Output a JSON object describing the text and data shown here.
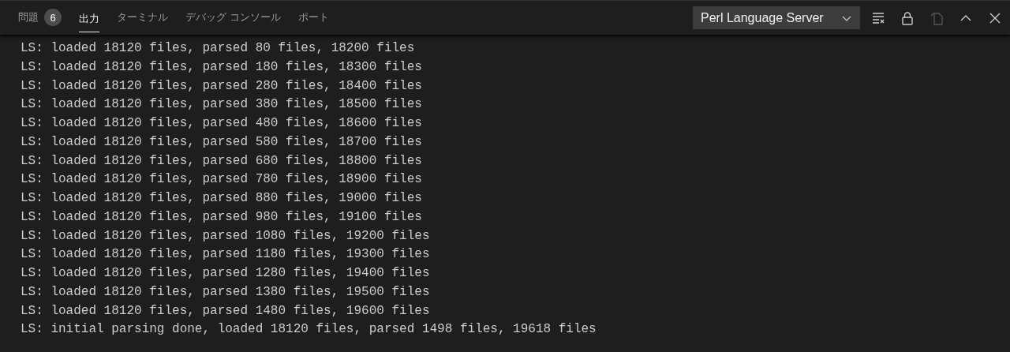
{
  "tabs": [
    {
      "label": "問題",
      "badge": "6",
      "selected": false
    },
    {
      "label": "出力",
      "selected": true
    },
    {
      "label": "ターミナル",
      "selected": false
    },
    {
      "label": "デバッグ コンソール",
      "selected": false
    },
    {
      "label": "ポート",
      "selected": false
    }
  ],
  "channel_dropdown": {
    "value": "Perl Language Server"
  },
  "toolbar": [
    {
      "kind": "clear",
      "disabled": false
    },
    {
      "kind": "lock",
      "disabled": false
    },
    {
      "kind": "copy",
      "disabled": true
    },
    {
      "kind": "maximize",
      "disabled": false
    },
    {
      "kind": "close",
      "disabled": false
    }
  ],
  "output_lines": [
    "LS: loaded 18120 files, parsed 80 files, 18200 files",
    "LS: loaded 18120 files, parsed 180 files, 18300 files",
    "LS: loaded 18120 files, parsed 280 files, 18400 files",
    "LS: loaded 18120 files, parsed 380 files, 18500 files",
    "LS: loaded 18120 files, parsed 480 files, 18600 files",
    "LS: loaded 18120 files, parsed 580 files, 18700 files",
    "LS: loaded 18120 files, parsed 680 files, 18800 files",
    "LS: loaded 18120 files, parsed 780 files, 18900 files",
    "LS: loaded 18120 files, parsed 880 files, 19000 files",
    "LS: loaded 18120 files, parsed 980 files, 19100 files",
    "LS: loaded 18120 files, parsed 1080 files, 19200 files",
    "LS: loaded 18120 files, parsed 1180 files, 19300 files",
    "LS: loaded 18120 files, parsed 1280 files, 19400 files",
    "LS: loaded 18120 files, parsed 1380 files, 19500 files",
    "LS: loaded 18120 files, parsed 1480 files, 19600 files",
    "LS: initial parsing done, loaded 18120 files, parsed 1498 files, 19618 files"
  ]
}
